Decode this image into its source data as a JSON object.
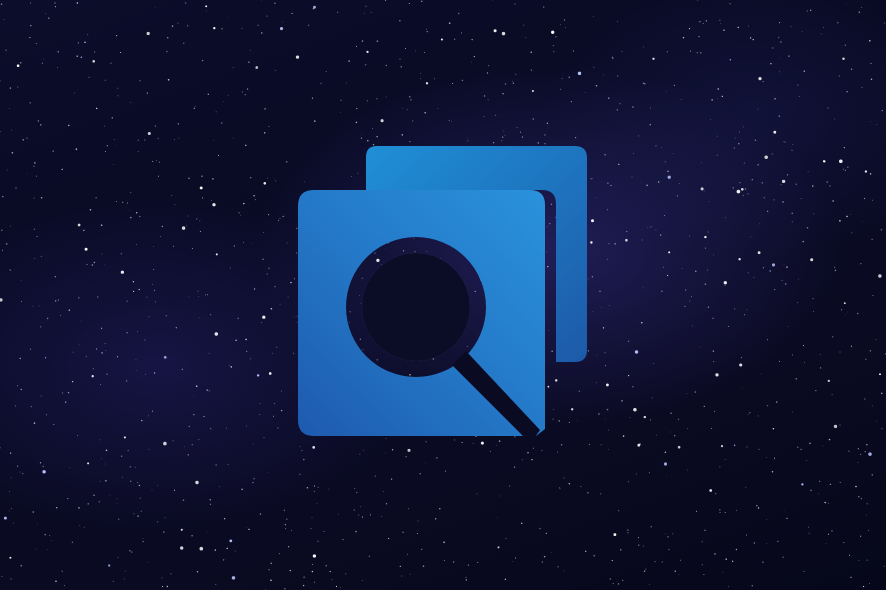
{
  "scene": {
    "background_color": "#07091c",
    "nebula_color": "#463caa",
    "star_color": "#ffffff"
  },
  "logo": {
    "icon": "stacked-squares-magnifier-icon",
    "front_square_gradient": [
      "#2a86d8",
      "#1e5fb0"
    ],
    "back_square_gradient": [
      "#1f8fd6",
      "#1d5aa8"
    ],
    "magnifier_color": "#0a0b22"
  }
}
